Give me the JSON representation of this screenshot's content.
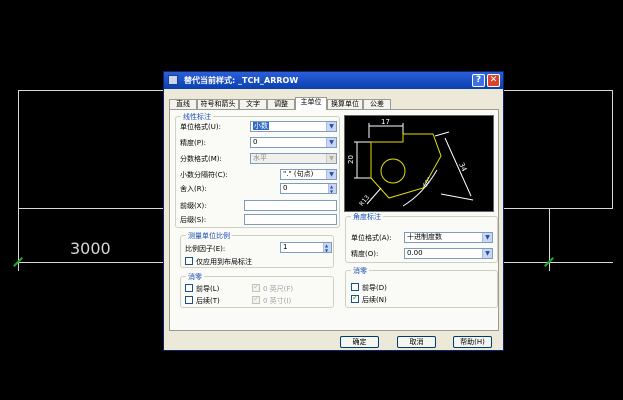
{
  "cad": {
    "dimension_text": "3000"
  },
  "dialog": {
    "title": "替代当前样式: _TCH_ARROW",
    "help_label": "?",
    "close_label": "✕",
    "tabs": [
      {
        "label": "直线",
        "active": false
      },
      {
        "label": "符号和箭头",
        "active": false
      },
      {
        "label": "文字",
        "active": false
      },
      {
        "label": "调整",
        "active": false
      },
      {
        "label": "主单位",
        "active": true
      },
      {
        "label": "换算单位",
        "active": false
      },
      {
        "label": "公差",
        "active": false
      }
    ],
    "linear": {
      "group_title": "线性标注",
      "unit_format_label": "单位格式(U):",
      "unit_format_value": "小数",
      "precision_label": "精度(P):",
      "precision_value": "0",
      "fraction_format_label": "分数格式(M):",
      "fraction_format_value": "水平",
      "decimal_sep_label": "小数分隔符(C):",
      "decimal_sep_value": "\".\"  (句点)",
      "round_off_label": "舍入(R):",
      "round_off_value": "0",
      "prefix_label": "前缀(X):",
      "prefix_value": "",
      "suffix_label": "后缀(S):",
      "suffix_value": ""
    },
    "measure_scale": {
      "group_title": "测量单位比例",
      "scale_factor_label": "比例因子(E):",
      "scale_factor_value": "1",
      "layout_only_label": "仅应用到布局标注",
      "layout_only_checked": false
    },
    "zero_suppress_linear": {
      "group_title": "消零",
      "leading_label": "前导(L)",
      "leading_checked": false,
      "trailing_label": "后续(T)",
      "trailing_checked": false,
      "feet_label": "0 英尺(F)",
      "feet_checked": true,
      "inches_label": "0 英寸(I)",
      "inches_checked": true
    },
    "preview": {
      "dim_17": "17",
      "dim_20": "20",
      "dim_34": "34",
      "dim_r13": "R13",
      "dim_60": "60°"
    },
    "angular": {
      "group_title": "角度标注",
      "unit_format_label": "单位格式(A):",
      "unit_format_value": "十进制度数",
      "precision_label": "精度(O):",
      "precision_value": "0.00"
    },
    "zero_suppress_angular": {
      "group_title": "消零",
      "leading_label": "前导(D)",
      "leading_checked": false,
      "trailing_label": "后续(N)",
      "trailing_checked": true
    },
    "buttons": {
      "ok": "确定",
      "cancel": "取消",
      "help": "帮助(H)"
    }
  },
  "colors": {
    "title_bar": "#0a3fb0",
    "dialog_bg": "#ece9d8",
    "group_title": "#1a4fb8",
    "cad_line": "#d8d8d8",
    "cad_tick": "#1faa2f"
  }
}
